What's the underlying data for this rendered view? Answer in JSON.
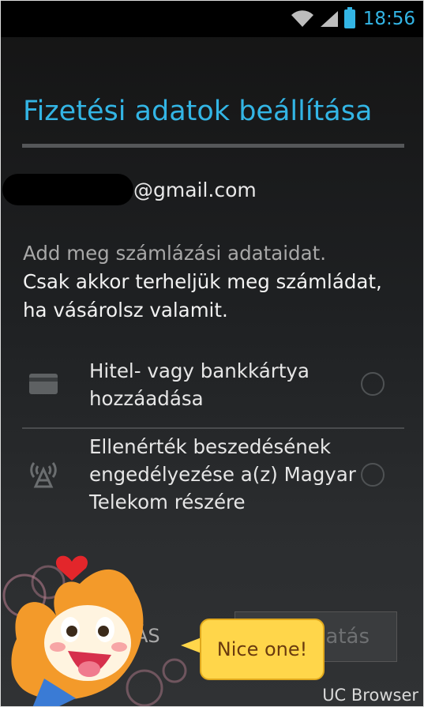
{
  "status_bar": {
    "time": "18:56",
    "icons": [
      "wifi-icon",
      "signal-icon",
      "battery-icon"
    ],
    "accent": "#33b5e5"
  },
  "header": {
    "title": "Fizetési adatok beállítása"
  },
  "account": {
    "email_domain": "@gmail.com"
  },
  "description": {
    "line_muted": "Add meg számlázási adataidat.",
    "line_main": "Csak akkor terheljük meg számládat, ha vásárolsz valamit."
  },
  "options": [
    {
      "icon": "credit-card-icon",
      "label": "Hitel- vagy bankkártya hozzáadása",
      "selected": false
    },
    {
      "icon": "carrier-billing-icon",
      "label": "Ellenérték beszedésének engedélyezése a(z) Magyar Telekom részére",
      "selected": false
    }
  ],
  "buttons": {
    "skip_visible": "ÁS",
    "next_visible": "atás"
  },
  "overlay": {
    "bubble_text": "Nice one!",
    "watermark": "UC Browser"
  }
}
